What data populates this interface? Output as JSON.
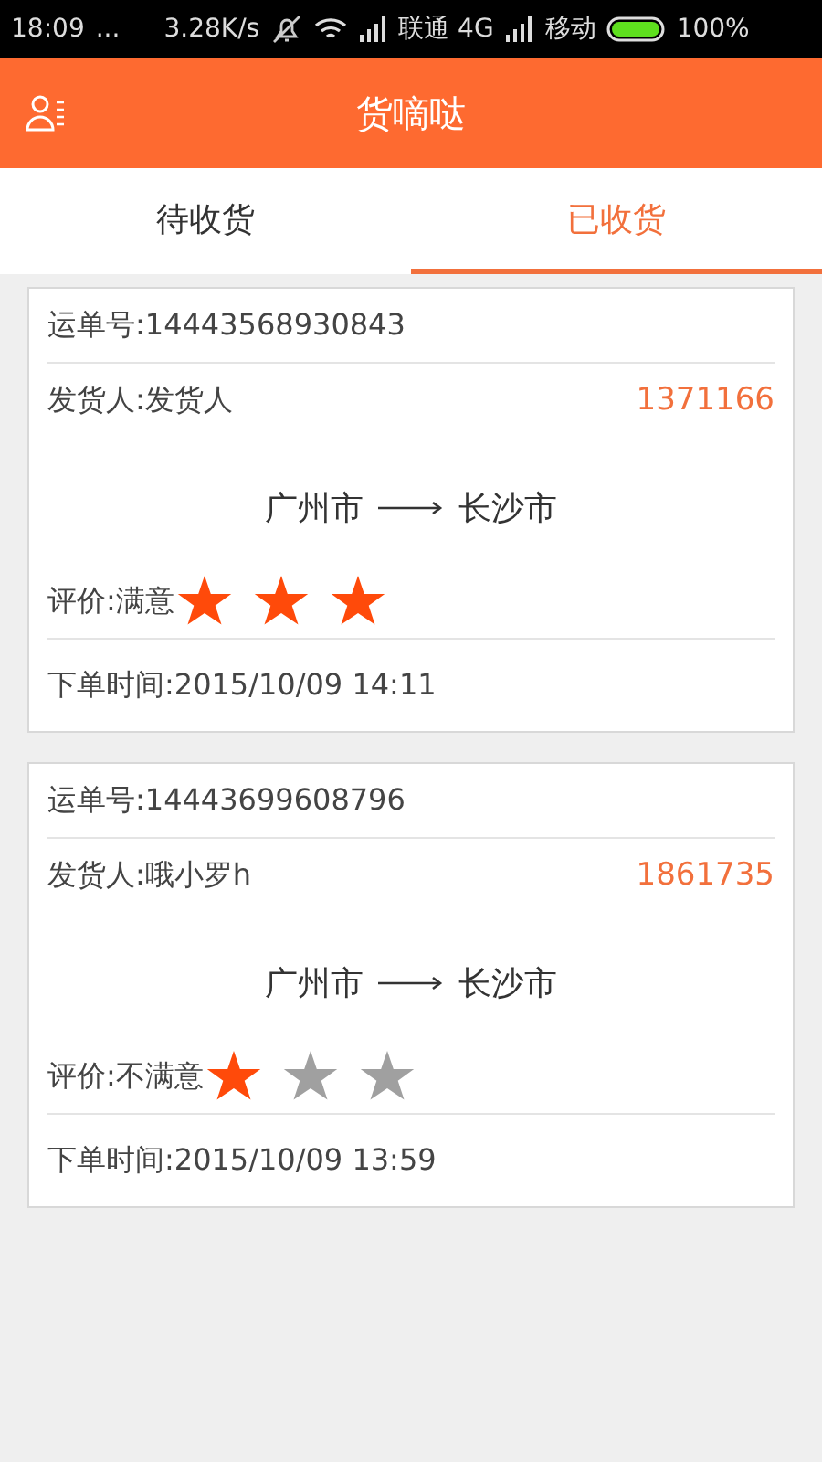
{
  "status_bar": {
    "time": "18:09",
    "dots": "...",
    "speed": "3.28K/s",
    "carrier_1": "联通 4G",
    "carrier_2": "移动",
    "battery": "100%"
  },
  "header": {
    "title": "货嘀哒"
  },
  "tabs": [
    {
      "label": "待收货",
      "selected": false
    },
    {
      "label": "已收货",
      "selected": true
    }
  ],
  "orders": [
    {
      "waybill": "运单号:14443568930843",
      "shipper": "发货人:发货人",
      "phone": "1371166",
      "from": "广州市",
      "to": "长沙市",
      "rating": "评价:满意",
      "stars": 3,
      "time": "下单时间:2015/10/09 14:11"
    },
    {
      "waybill": "运单号:14443699608796",
      "shipper": "发货人:哦小罗h",
      "phone": "1861735",
      "from": "广州市",
      "to": "长沙市",
      "rating": "评价:不满意",
      "stars": 1,
      "time": "下单时间:2015/10/09 13:59"
    }
  ]
}
